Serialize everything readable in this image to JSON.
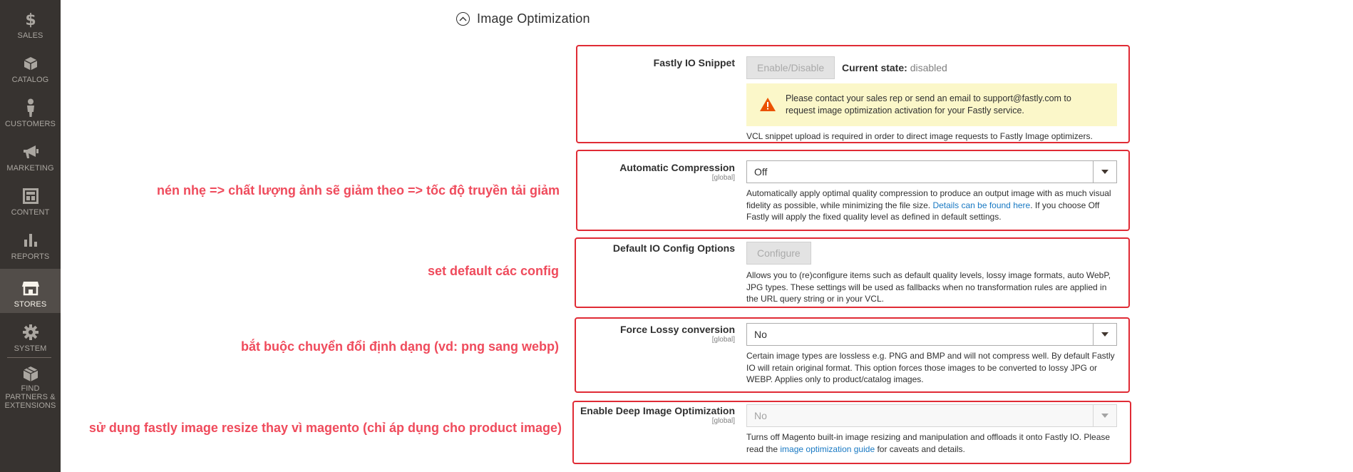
{
  "sidebar": {
    "items": [
      {
        "label": "SALES",
        "icon": "dollar-icon"
      },
      {
        "label": "CATALOG",
        "icon": "cube-icon"
      },
      {
        "label": "CUSTOMERS",
        "icon": "person-icon"
      },
      {
        "label": "MARKETING",
        "icon": "megaphone-icon"
      },
      {
        "label": "CONTENT",
        "icon": "layout-icon"
      },
      {
        "label": "REPORTS",
        "icon": "bar-chart-icon"
      },
      {
        "label": "STORES",
        "icon": "store-icon",
        "active": true
      },
      {
        "label": "SYSTEM",
        "icon": "gear-icon"
      },
      {
        "label": "FIND PARTNERS & EXTENSIONS",
        "icon": "boxes-icon"
      }
    ]
  },
  "section": {
    "title": "Image Optimization"
  },
  "snippet": {
    "label": "Fastly IO Snippet",
    "button": "Enable/Disable",
    "state_label": "Current state:",
    "state_value": "disabled",
    "warning": "Please contact your sales rep or send an email to support@fastly.com to request image optimization activation for your Fastly service.",
    "note": "VCL snippet upload is required in order to direct image requests to Fastly Image optimizers."
  },
  "compression": {
    "label": "Automatic Compression",
    "scope": "[global]",
    "value": "Off",
    "note_before": "Automatically apply optimal quality compression to produce an output image with as much visual fidelity as possible, while minimizing the file size. ",
    "note_link": "Details can be found here",
    "note_after": ". If you choose Off Fastly will apply the fixed quality level as defined in default settings."
  },
  "config": {
    "label": "Default IO Config Options",
    "button": "Configure",
    "note": "Allows you to (re)configure items such as default quality levels, lossy image formats, auto WebP, JPG types. These settings will be used as fallbacks when no transformation rules are applied in the URL query string or in your VCL."
  },
  "lossy": {
    "label": "Force Lossy conversion",
    "scope": "[global]",
    "value": "No",
    "note": "Certain image types are lossless e.g. PNG and BMP and will not compress well. By default Fastly IO will retain original format. This option forces those images to be converted to lossy JPG or WEBP. Applies only to product/catalog images."
  },
  "deep": {
    "label": "Enable Deep Image Optimization",
    "scope": "[global]",
    "value": "No",
    "note_before": "Turns off Magento built-in image resizing and manipulation and offloads it onto Fastly IO. Please read the ",
    "note_link": "image optimization guide",
    "note_after": " for caveats and details."
  },
  "annotations": [
    "nén nhẹ => chất lượng ảnh sẽ giảm theo => tốc độ truyền tải giảm",
    "set default các config",
    "bắt buộc chuyển đổi định dạng (vd: png sang webp)",
    "sử dụng fastly image resize thay vì magento (chỉ áp dụng cho product image)"
  ],
  "colors": {
    "sidebar": "#373330",
    "active": "#524d49",
    "annotation": "#ef4b5c",
    "link": "#1979c3",
    "warning_bg": "#fbf7c9"
  }
}
